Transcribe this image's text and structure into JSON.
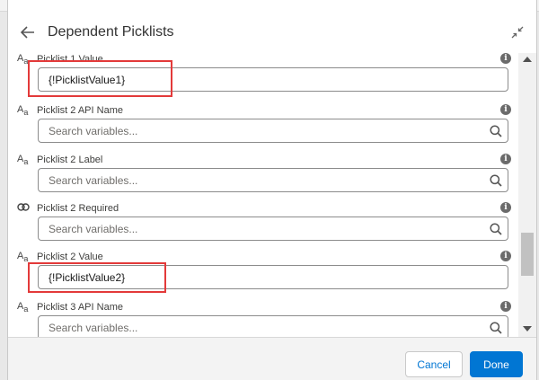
{
  "header": {
    "title": "Dependent Picklists"
  },
  "fields": [
    {
      "label": "Picklist 1 Value",
      "type_icon": "text-type-icon",
      "value": "{!PicklistValue1}",
      "placeholder": ""
    },
    {
      "label": "Picklist 2 API Name",
      "type_icon": "text-type-icon",
      "value": "",
      "placeholder": "Search variables..."
    },
    {
      "label": "Picklist 2 Label",
      "type_icon": "text-type-icon",
      "value": "",
      "placeholder": "Search variables..."
    },
    {
      "label": "Picklist 2 Required",
      "type_icon": "boolean-type-icon",
      "value": "",
      "placeholder": "Search variables..."
    },
    {
      "label": "Picklist 2 Value",
      "type_icon": "text-type-icon",
      "value": "{!PicklistValue2}",
      "placeholder": ""
    },
    {
      "label": "Picklist 3 API Name",
      "type_icon": "text-type-icon",
      "value": "",
      "placeholder": "Search variables..."
    }
  ],
  "footer": {
    "cancel_label": "Cancel",
    "done_label": "Done"
  },
  "colors": {
    "highlight": "#e33a3a",
    "brand": "#0176d3"
  }
}
